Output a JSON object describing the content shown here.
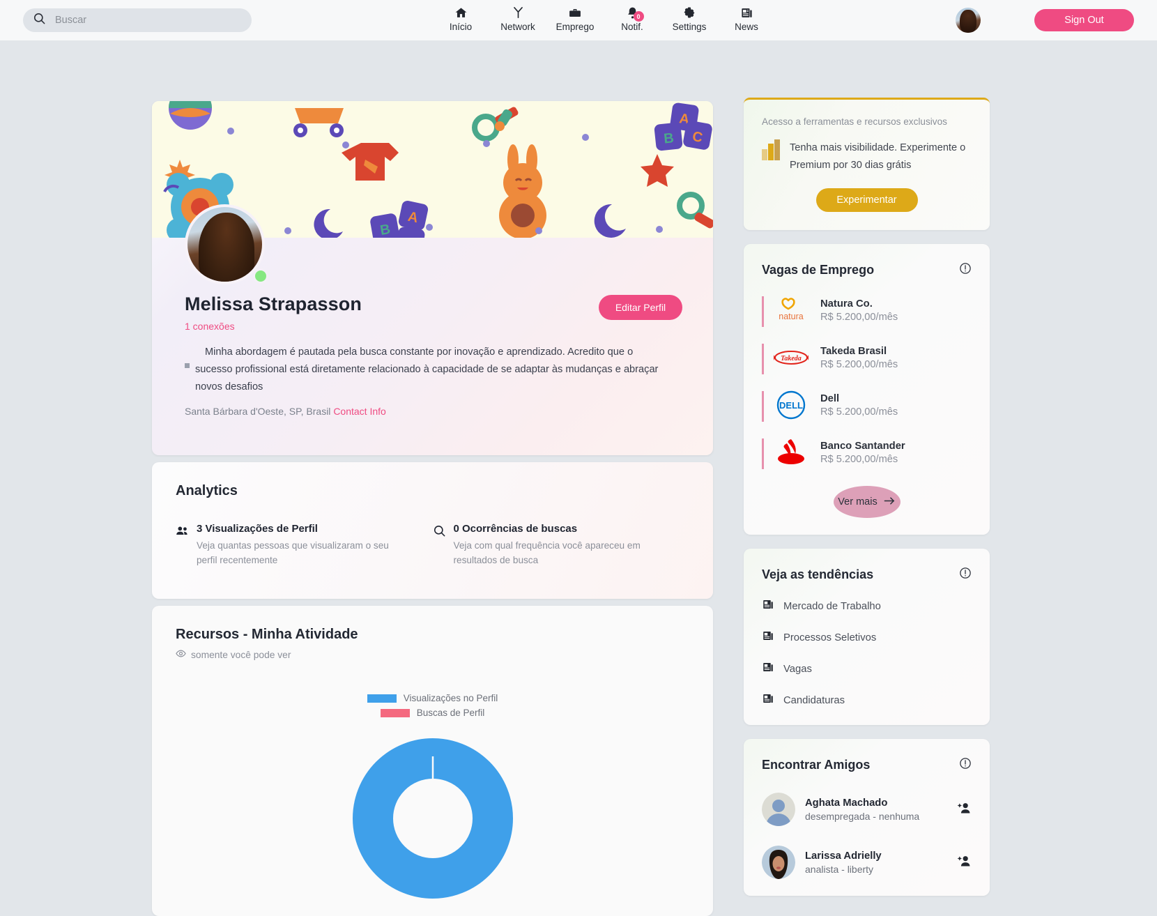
{
  "topbar": {
    "search": {
      "placeholder": "Buscar",
      "value": "",
      "icon": "search-icon"
    },
    "nav": [
      {
        "label": "Início",
        "icon": "home-icon"
      },
      {
        "label": "Network",
        "icon": "network-icon"
      },
      {
        "label": "Emprego",
        "icon": "briefcase-icon"
      },
      {
        "label": "Notif.",
        "icon": "bell-icon",
        "badge": "0"
      },
      {
        "label": "Settings",
        "icon": "gear-icon"
      },
      {
        "label": "News",
        "icon": "news-icon"
      }
    ],
    "sign_out_label": "Sign Out",
    "avatar_alt": "Melissa Strapasson"
  },
  "profile": {
    "name": "Melissa Strapasson",
    "connections": "1 conexões",
    "edit_label": "Editar Perfil",
    "about": "Minha abordagem é pautada pela busca constante por inovação e aprendizado. Acredito que o sucesso profissional está diretamente relacionado à capacidade de se adaptar às mudanças e abraçar novos desafios",
    "location": "Santa Bárbara d'Oeste, SP, Brasil",
    "contact_info": "Contact Info"
  },
  "analytics": {
    "title": "Analytics",
    "items": [
      {
        "icon": "people-icon",
        "headline": "3 Visualizações de Perfil",
        "sub": "Veja quantas pessoas que visualizaram o seu perfil recentemente"
      },
      {
        "icon": "search-icon",
        "headline": "0 Ocorrências de buscas",
        "sub": "Veja com qual frequência você apareceu em resultados de busca"
      }
    ]
  },
  "recursos": {
    "title": "Recursos - Minha Atividade",
    "visibility": "somente você pode ver",
    "visibility_icon": "eye-icon"
  },
  "chart_data": {
    "type": "pie",
    "title": "Recursos - Minha Atividade",
    "variant": "donut",
    "labels": [
      "Visualizações no Perfil",
      "Buscas de Perfil"
    ],
    "values": [
      3,
      0
    ],
    "colors": [
      "#3fa0ea",
      "#f4697f"
    ],
    "legend_position": "top",
    "grid": false
  },
  "premium": {
    "tagline": "Acesso a ferramentas e recursos exclusivos",
    "icon": "bar-chart-icon",
    "headline": "Tenha mais visibilidade. Experimente o Premium por 30 dias grátis",
    "button_label": "Experimentar",
    "accent": "#dda918"
  },
  "jobs": {
    "title": "Vagas de Emprego",
    "info_icon": "info-icon",
    "items": [
      {
        "company": "Natura Co.",
        "pay": "R$ 5.200,00/mês",
        "logo": "natura-logo"
      },
      {
        "company": "Takeda Brasil",
        "pay": "R$ 5.200,00/mês",
        "logo": "takeda-logo"
      },
      {
        "company": "Dell",
        "pay": "R$ 5.200,00/mês",
        "logo": "dell-logo"
      },
      {
        "company": "Banco Santander",
        "pay": "R$ 5.200,00/mês",
        "logo": "santander-logo"
      }
    ],
    "more_label": "Ver mais",
    "more_icon": "arrow-right-icon"
  },
  "trends": {
    "title": "Veja as tendências",
    "info_icon": "info-icon",
    "items": [
      {
        "label": "Mercado de Trabalho",
        "icon": "news-icon"
      },
      {
        "label": "Processos Seletivos",
        "icon": "news-icon"
      },
      {
        "label": "Vagas",
        "icon": "news-icon"
      },
      {
        "label": "Candidaturas",
        "icon": "news-icon"
      }
    ]
  },
  "friends": {
    "title": "Encontrar Amigos",
    "info_icon": "info-icon",
    "items": [
      {
        "name": "Aghata Machado",
        "role": "desempregada - nenhuma",
        "action_icon": "add-person-icon"
      },
      {
        "name": "Larissa Adrielly",
        "role": "analista - liberty",
        "action_icon": "add-person-icon"
      }
    ]
  }
}
